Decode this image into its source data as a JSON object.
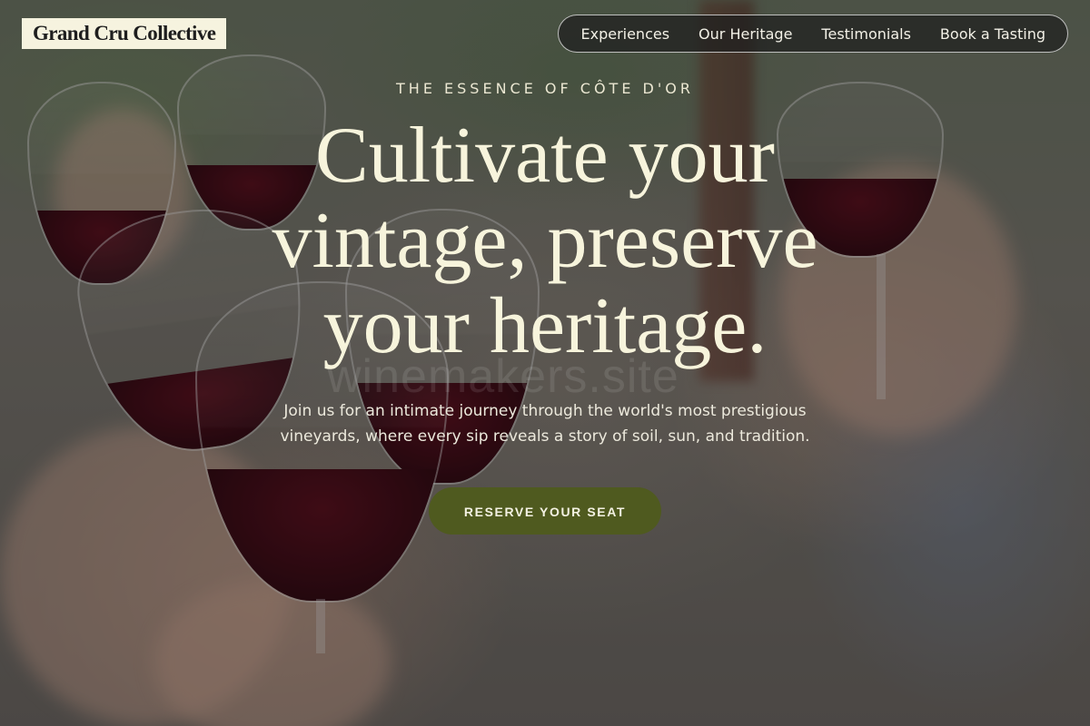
{
  "brand": {
    "name": "Grand Cru Collective"
  },
  "nav": {
    "items": [
      {
        "label": "Experiences"
      },
      {
        "label": "Our Heritage"
      },
      {
        "label": "Testimonials"
      },
      {
        "label": "Book a Tasting"
      }
    ]
  },
  "hero": {
    "eyebrow": "THE ESSENCE OF CÔTE D'OR",
    "headline": "Cultivate your vintage, preserve your heritage.",
    "subtext": "Join us for an intimate journey through the world's most prestigious vineyards, where every sip reveals a story of soil, sun, and tradition.",
    "cta_label": "RESERVE YOUR SEAT"
  },
  "watermark": "winemakers.site",
  "colors": {
    "brand_bg": "#f6f3df",
    "cta_bg": "#4f5a1f",
    "headline": "#f7f4dc",
    "nav_bg": "#1e1e1e"
  }
}
